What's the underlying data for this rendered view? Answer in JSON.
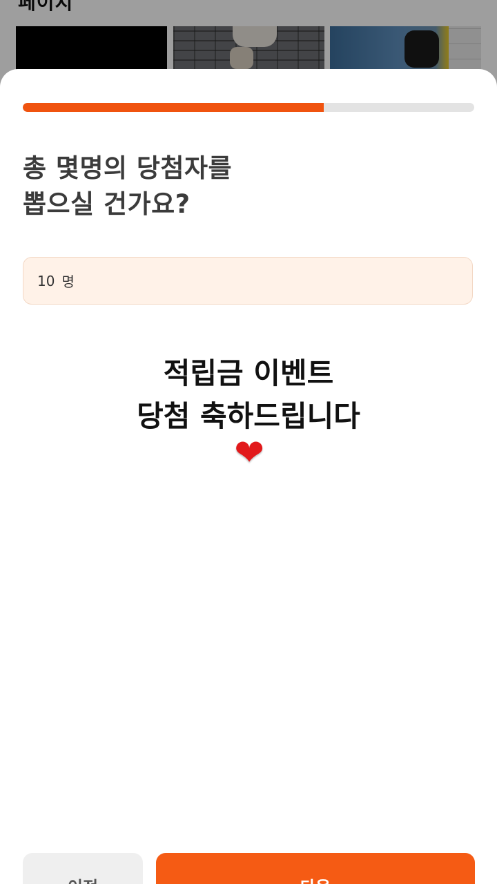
{
  "background_page": {
    "section_title": "페이지"
  },
  "sheet": {
    "progress": {
      "fraction": 0.667,
      "fill_color": "#f0530f",
      "track_color": "#e3e3e3"
    },
    "question": {
      "line1": "총 몇명의 당첨자를",
      "line2": "뽑으실 건가요?"
    },
    "winner_count": {
      "value": "10",
      "unit": "명"
    },
    "overlay_caption": {
      "line1": "적립금 이벤트",
      "line2": "당첨 축하드립니다",
      "heart": "❤"
    },
    "buttons": {
      "prev_label": "이전",
      "next_label": "다음",
      "next_color": "#f55b14"
    }
  }
}
